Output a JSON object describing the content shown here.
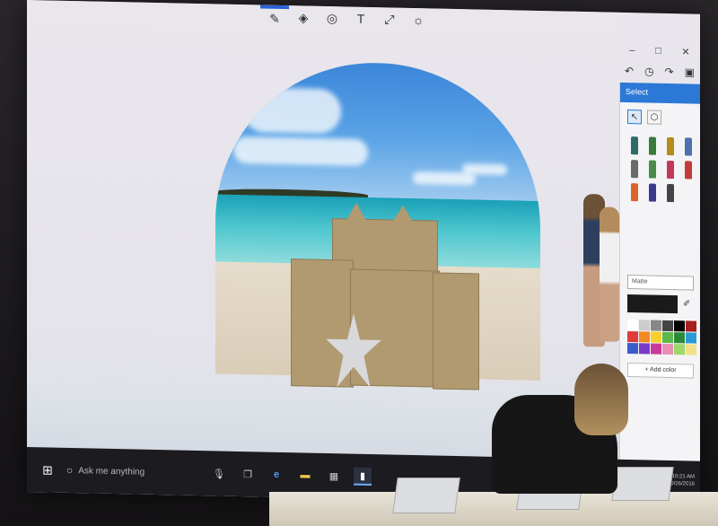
{
  "app": {
    "toolbar_icons": [
      "brush-icon",
      "3d-object-icon",
      "sticker-icon",
      "text-icon",
      "canvas-icon",
      "effects-icon"
    ],
    "window_controls": [
      "minimize",
      "maximize",
      "close"
    ],
    "history_controls": [
      "undo-icon",
      "history-icon",
      "redo-icon",
      "paste-icon"
    ]
  },
  "side_panel": {
    "title": "Select",
    "modes": [
      "select-icon",
      "magic-select-icon"
    ],
    "brushes": [
      {
        "name": "marker",
        "color": "#2e6b6a"
      },
      {
        "name": "calligraphy-pen",
        "color": "#3a7a3a"
      },
      {
        "name": "oil-brush",
        "color": "#b58b1a"
      },
      {
        "name": "watercolor",
        "color": "#4f6fb0"
      },
      {
        "name": "pixel-pen",
        "color": "#6a6a6a"
      },
      {
        "name": "pencil",
        "color": "#4a8a4a"
      },
      {
        "name": "eraser",
        "color": "#c2385a"
      },
      {
        "name": "crayon",
        "color": "#c23a3a"
      },
      {
        "name": "spray-can",
        "color": "#d8652a"
      },
      {
        "name": "fill",
        "color": "#3a3a8a"
      },
      {
        "name": "line",
        "color": "#444444"
      }
    ],
    "material": "Matte",
    "current_color": "#1a1a1a",
    "swatches": [
      "#ffffff",
      "#cccccc",
      "#888888",
      "#444444",
      "#000000",
      "#a61e1e",
      "#e03b3b",
      "#f08a24",
      "#f6d02a",
      "#5cb84a",
      "#2a8a3a",
      "#2a9ad6",
      "#3b5cc8",
      "#7a3bc8",
      "#c83b9a",
      "#e88fb4",
      "#9ed86a",
      "#f4e08a"
    ],
    "add_color_label": "+ Add color"
  },
  "taskbar": {
    "search_placeholder": "Ask me anything",
    "apps": [
      "task-view-icon",
      "edge-icon",
      "file-explorer-icon",
      "store-icon",
      "paint-3d-icon"
    ],
    "clock_time": "10:21 AM",
    "clock_date": "10/26/2016"
  }
}
